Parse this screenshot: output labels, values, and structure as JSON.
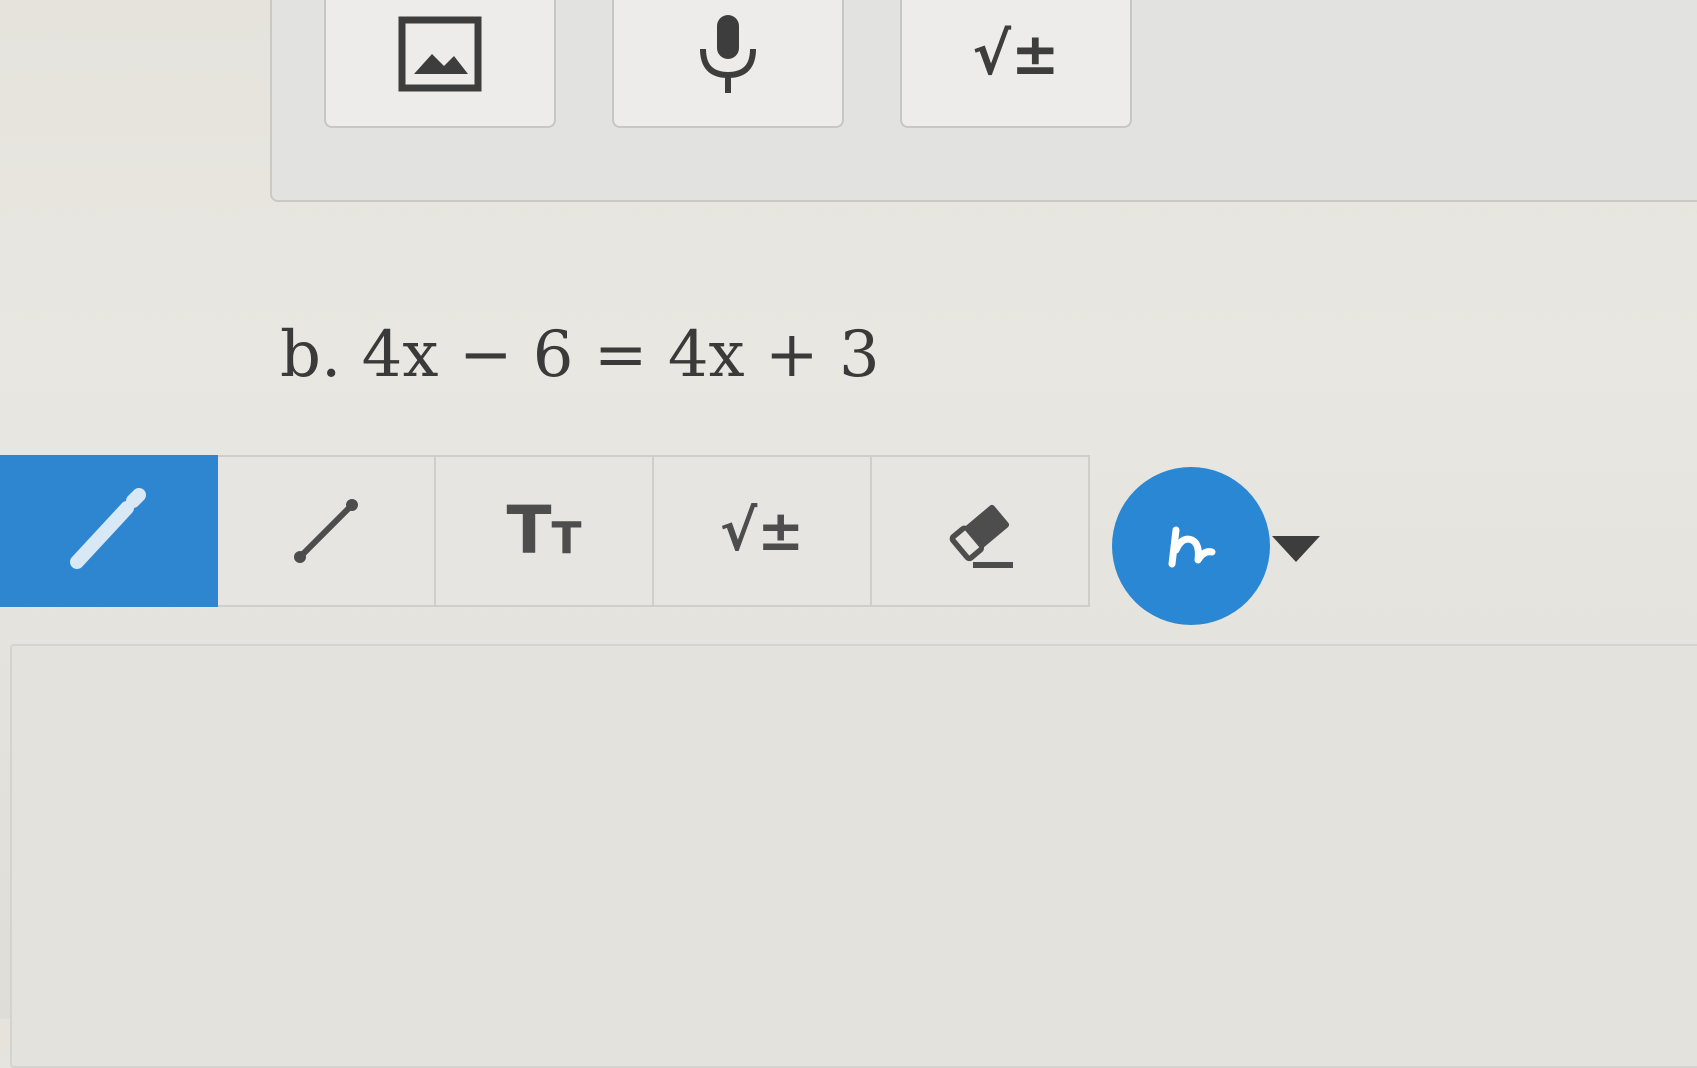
{
  "top_toolbar": {
    "buttons": [
      {
        "icon": "image-icon"
      },
      {
        "icon": "microphone-icon"
      },
      {
        "icon": "math-sqrt-icon",
        "label": "√±"
      }
    ]
  },
  "question": {
    "label": "b. 4x − 6 = 4x + 3"
  },
  "drawing_toolbar": {
    "tools": [
      {
        "icon": "pencil-icon",
        "active": true
      },
      {
        "icon": "line-icon"
      },
      {
        "icon": "text-size-icon",
        "label_big": "T",
        "label_small": "T"
      },
      {
        "icon": "math-sqrt-icon",
        "label": "√±"
      },
      {
        "icon": "eraser-icon"
      }
    ],
    "active_color": "#2a87d3"
  },
  "colors": {
    "accent": "#2f86d0",
    "icon": "#4d4d4d"
  }
}
